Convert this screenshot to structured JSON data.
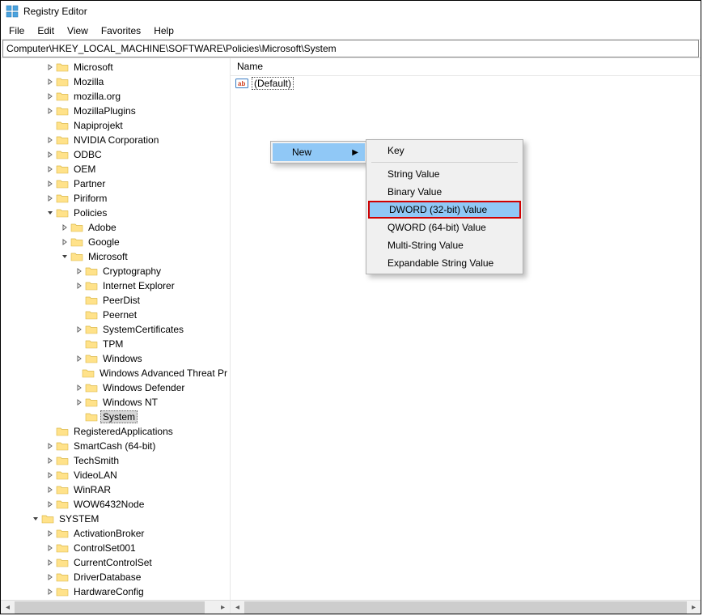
{
  "app": {
    "title": "Registry Editor"
  },
  "menu": {
    "file": "File",
    "edit": "Edit",
    "view": "View",
    "favorites": "Favorites",
    "help": "Help"
  },
  "address": {
    "path": "Computer\\HKEY_LOCAL_MACHINE\\SOFTWARE\\Policies\\Microsoft\\System"
  },
  "tree_nodes": [
    {
      "depth": 3,
      "expander": "closed",
      "label": "Microsoft"
    },
    {
      "depth": 3,
      "expander": "closed",
      "label": "Mozilla"
    },
    {
      "depth": 3,
      "expander": "closed",
      "label": "mozilla.org"
    },
    {
      "depth": 3,
      "expander": "closed",
      "label": "MozillaPlugins"
    },
    {
      "depth": 3,
      "expander": "none",
      "label": "Napiprojekt"
    },
    {
      "depth": 3,
      "expander": "closed",
      "label": "NVIDIA Corporation"
    },
    {
      "depth": 3,
      "expander": "closed",
      "label": "ODBC"
    },
    {
      "depth": 3,
      "expander": "closed",
      "label": "OEM"
    },
    {
      "depth": 3,
      "expander": "closed",
      "label": "Partner"
    },
    {
      "depth": 3,
      "expander": "closed",
      "label": "Piriform"
    },
    {
      "depth": 3,
      "expander": "open",
      "label": "Policies"
    },
    {
      "depth": 4,
      "expander": "closed",
      "label": "Adobe"
    },
    {
      "depth": 4,
      "expander": "closed",
      "label": "Google"
    },
    {
      "depth": 4,
      "expander": "open",
      "label": "Microsoft"
    },
    {
      "depth": 5,
      "expander": "closed",
      "label": "Cryptography"
    },
    {
      "depth": 5,
      "expander": "closed",
      "label": "Internet Explorer"
    },
    {
      "depth": 5,
      "expander": "none",
      "label": "PeerDist"
    },
    {
      "depth": 5,
      "expander": "none",
      "label": "Peernet"
    },
    {
      "depth": 5,
      "expander": "closed",
      "label": "SystemCertificates"
    },
    {
      "depth": 5,
      "expander": "none",
      "label": "TPM"
    },
    {
      "depth": 5,
      "expander": "closed",
      "label": "Windows"
    },
    {
      "depth": 5,
      "expander": "none",
      "label": "Windows Advanced Threat Pr"
    },
    {
      "depth": 5,
      "expander": "closed",
      "label": "Windows Defender"
    },
    {
      "depth": 5,
      "expander": "closed",
      "label": "Windows NT"
    },
    {
      "depth": 5,
      "expander": "none",
      "label": "System",
      "selected": true
    },
    {
      "depth": 3,
      "expander": "none",
      "label": "RegisteredApplications"
    },
    {
      "depth": 3,
      "expander": "closed",
      "label": "SmartCash (64-bit)"
    },
    {
      "depth": 3,
      "expander": "closed",
      "label": "TechSmith"
    },
    {
      "depth": 3,
      "expander": "closed",
      "label": "VideoLAN"
    },
    {
      "depth": 3,
      "expander": "closed",
      "label": "WinRAR"
    },
    {
      "depth": 3,
      "expander": "closed",
      "label": "WOW6432Node"
    },
    {
      "depth": 2,
      "expander": "open",
      "label": "SYSTEM"
    },
    {
      "depth": 3,
      "expander": "closed",
      "label": "ActivationBroker"
    },
    {
      "depth": 3,
      "expander": "closed",
      "label": "ControlSet001"
    },
    {
      "depth": 3,
      "expander": "closed",
      "label": "CurrentControlSet"
    },
    {
      "depth": 3,
      "expander": "closed",
      "label": "DriverDatabase"
    },
    {
      "depth": 3,
      "expander": "closed",
      "label": "HardwareConfig"
    }
  ],
  "list": {
    "columns": {
      "name": "Name"
    },
    "values": [
      {
        "icon": "ab",
        "name": "(Default)"
      }
    ]
  },
  "context_menu": {
    "parent_label": "New",
    "items": [
      {
        "label": "Key",
        "separator_after": true
      },
      {
        "label": "String Value"
      },
      {
        "label": "Binary Value"
      },
      {
        "label": "DWORD (32-bit) Value",
        "highlight": true
      },
      {
        "label": "QWORD (64-bit) Value"
      },
      {
        "label": "Multi-String Value"
      },
      {
        "label": "Expandable String Value"
      }
    ]
  }
}
